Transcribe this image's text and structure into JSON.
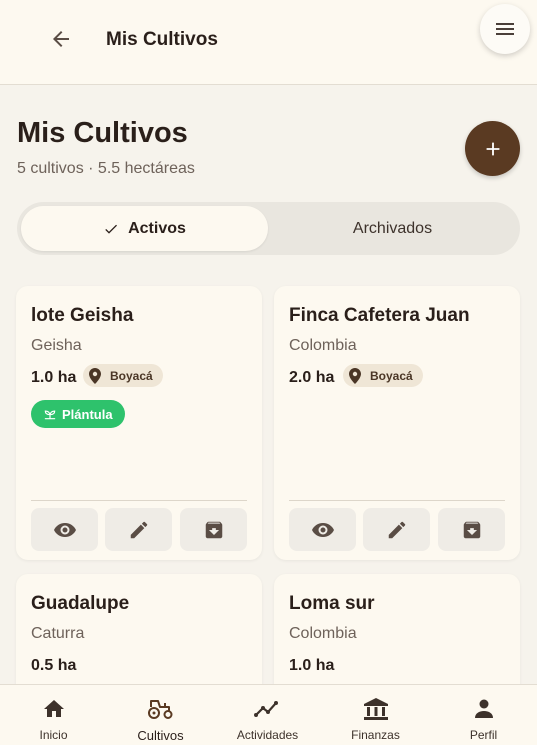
{
  "topbar": {
    "title": "Mis Cultivos"
  },
  "header": {
    "title": "Mis Cultivos",
    "subtitle": "5 cultivos · 5.5 hectáreas"
  },
  "tabs": [
    {
      "label": "Activos",
      "selected": true
    },
    {
      "label": "Archivados",
      "selected": false
    }
  ],
  "crops": [
    {
      "name": "lote Geisha",
      "variety": "Geisha",
      "area": "1.0 ha",
      "location": "Boyacá",
      "stage": "Plántula"
    },
    {
      "name": "Finca Cafetera Juan",
      "variety": "Colombia",
      "area": "2.0 ha",
      "location": "Boyacá"
    },
    {
      "name": "Guadalupe",
      "variety": "Caturra",
      "area": "0.5 ha"
    },
    {
      "name": "Loma sur",
      "variety": "Colombia",
      "area": "1.0 ha"
    }
  ],
  "nav": [
    {
      "label": "Inicio",
      "icon": "home-icon"
    },
    {
      "label": "Cultivos",
      "icon": "tractor-icon",
      "active": true
    },
    {
      "label": "Actividades",
      "icon": "activity-chart-icon"
    },
    {
      "label": "Finanzas",
      "icon": "bank-icon"
    },
    {
      "label": "Perfil",
      "icon": "person-icon"
    }
  ],
  "colors": {
    "brand_brown": "#5a3a22",
    "stage_green": "#2ec26c",
    "background": "#f6f3ec",
    "card": "#fdf9f0"
  }
}
